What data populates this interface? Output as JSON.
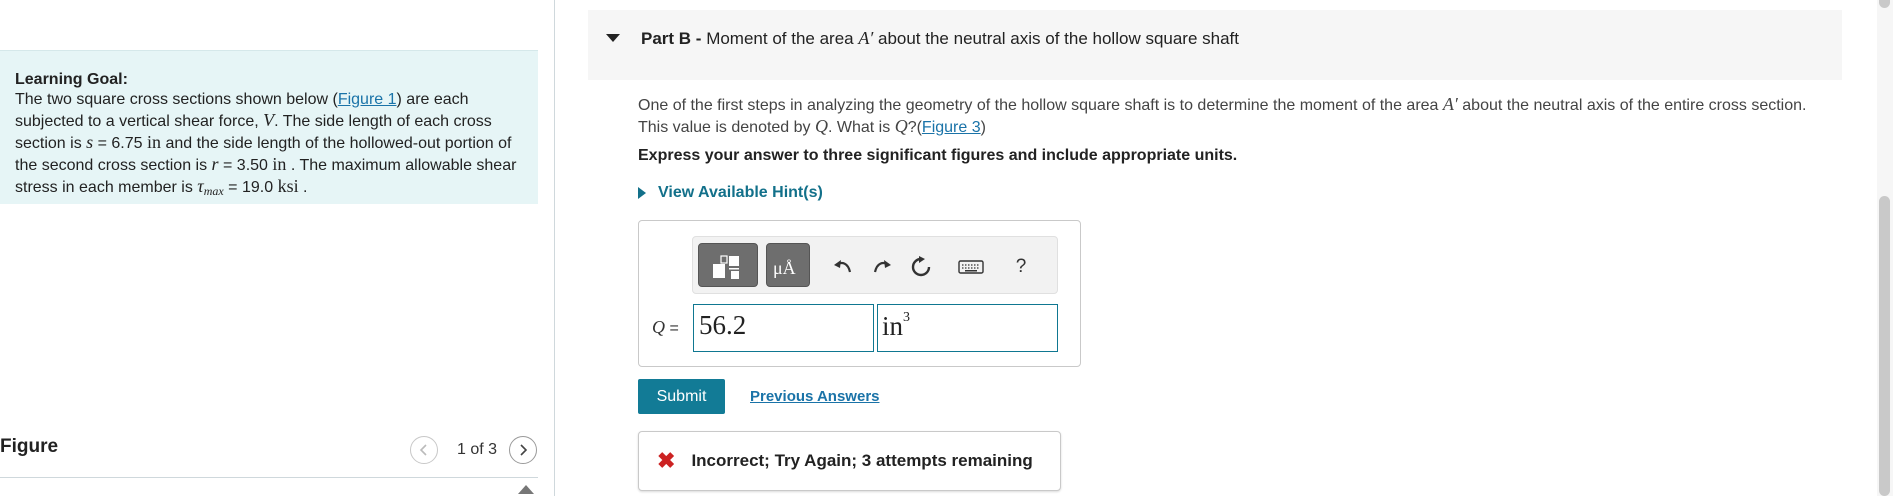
{
  "learning_goal": {
    "title": "Learning Goal:",
    "text_1": "The two square cross sections shown below (",
    "figure_link": "Figure 1",
    "text_2": ") are each subjected to a vertical shear force, ",
    "shear_symbol": "V",
    "text_3": ". The side length of each cross section is ",
    "s_symbol": "s",
    "s_value": " = 6.75 ",
    "s_unit": "in",
    "text_4": " and the side length of the hollowed-out portion of the second cross section is ",
    "r_symbol": "r",
    "r_value": " = 3.50 ",
    "r_unit": "in",
    "text_5": " . The maximum allowable shear stress in each member is ",
    "tau_symbol": "τ",
    "tau_sub": "max",
    "tau_value": " = 19.0 ",
    "tau_unit": "ksi",
    "text_6": " ."
  },
  "figure": {
    "label": "Figure",
    "pager_text": "1 of 3"
  },
  "part": {
    "prefix": "Part B",
    "dash": " - ",
    "title_1": "Moment of the area ",
    "area_symbol": "A′",
    "title_2": " about the neutral axis of the hollow square shaft"
  },
  "question": {
    "text_1": "One of the first steps in analyzing the geometry of the hollow square shaft is to determine the moment of the area ",
    "area_symbol": "A′",
    "text_2": " about the neutral axis of the entire cross section. This value is denoted by ",
    "q_symbol": "Q",
    "text_3": ". What is ",
    "q_symbol_2": "Q",
    "text_4": "?(",
    "figure_link": "Figure 3",
    "text_5": ")"
  },
  "instruction": "Express your answer to three significant figures and include appropriate units.",
  "hints_label": "View Available Hint(s)",
  "toolbar": {
    "units_label": "μÅ",
    "help_label": "?"
  },
  "answer": {
    "label_symbol": "Q",
    "label_eq": " =",
    "value": "56.2",
    "unit": "in",
    "unit_exp": "3"
  },
  "submit_label": "Submit",
  "previous_answers_label": "Previous Answers",
  "feedback": {
    "icon": "✖",
    "message": "Incorrect; Try Again; 3 attempts remaining",
    "color": "#cc2222"
  },
  "colors": {
    "accent": "#127b96",
    "goal_background": "#e6f5f6",
    "link": "#1a73a8"
  }
}
